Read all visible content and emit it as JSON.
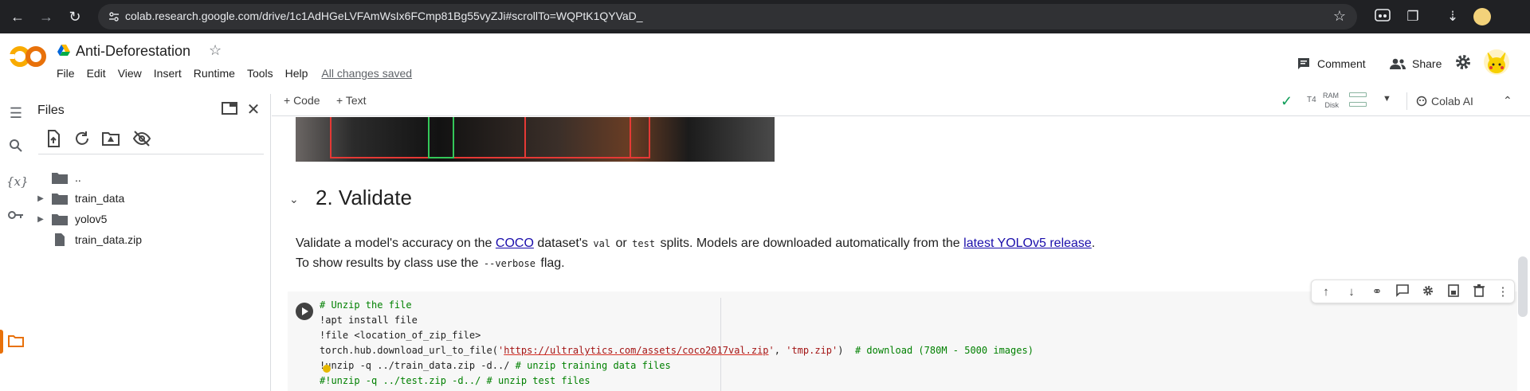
{
  "browser": {
    "url": "colab.research.google.com/drive/1c1AdHGeLVFAmWsIx6FCmp81Bg55vyZJi#scrollTo=WQPtK1QYVaD_",
    "icons": [
      "back-icon",
      "forward-icon",
      "reload-icon",
      "site-info-icon",
      "bookmark-star-icon",
      "incognito-extension-icon",
      "extensions-icon",
      "downloads-icon",
      "profile-icon"
    ]
  },
  "header": {
    "title": "Anti-Deforestation",
    "menu": [
      "File",
      "Edit",
      "View",
      "Insert",
      "Runtime",
      "Tools",
      "Help"
    ],
    "saved_status": "All changes saved",
    "comment_label": "Comment",
    "share_label": "Share",
    "colors": {
      "logo_orange": "#f9ab00",
      "logo_dark_orange": "#e8710a"
    }
  },
  "files_panel": {
    "title": "Files",
    "items": [
      {
        "name": "..",
        "type": "parent"
      },
      {
        "name": "train_data",
        "type": "folder"
      },
      {
        "name": "yolov5",
        "type": "folder"
      },
      {
        "name": "train_data.zip",
        "type": "file"
      }
    ]
  },
  "toolbar": {
    "code_label": "+ Code",
    "text_label": "+ Text",
    "gpu": "T4",
    "ram_label": "RAM",
    "disk_label": "Disk",
    "colab_ai_label": "Colab AI"
  },
  "section": {
    "heading": "2. Validate",
    "md1": {
      "t1": "Validate a model's accuracy on the ",
      "link1": "COCO",
      "t2": " dataset's ",
      "code1": "val",
      "t3": " or ",
      "code2": "test",
      "t4": " splits. Models are downloaded automatically from the ",
      "link2": "latest YOLOv5 release",
      "t5": "."
    },
    "md2": {
      "t1": "To show results by class use the ",
      "code1": "--verbose",
      "t2": " flag."
    }
  },
  "code": {
    "l1": "# Unzip the file",
    "l2": "!apt install file",
    "l3": "!file <location_of_zip_file>",
    "l4_pre": "torch.hub.download_url_to_file(",
    "l4_q1": "'",
    "l4_url": "https://ultralytics.com/assets/coco2017val.zip",
    "l4_q2": "'",
    "l4_mid": ", ",
    "l4_str2": "'tmp.zip'",
    "l4_post": ")  ",
    "l4_comment": "# download (780M - 5000 images)",
    "l5_code": "!unzip -q ../train_data.zip -d../ ",
    "l5_comment": "# unzip training data files",
    "l6": "#!unzip -q ../test.zip -d../ # unzip test files"
  },
  "cell_toolbar_icons": [
    "move-up-icon",
    "move-down-icon",
    "link-icon",
    "comment-icon",
    "gear-icon",
    "mirror-cell-icon",
    "delete-icon",
    "more-icon"
  ]
}
